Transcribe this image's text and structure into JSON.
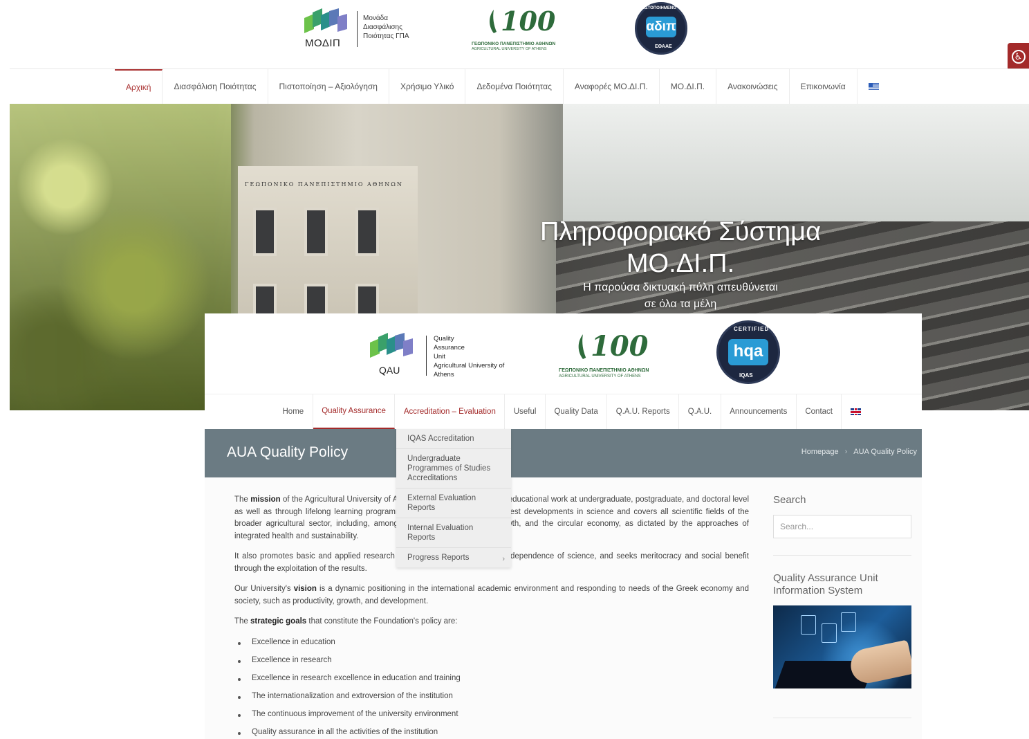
{
  "gr": {
    "logo": {
      "abbr": "ΜΟΔΙΠ",
      "subtitle": "Μονάδα\nΔιασφάλισης\nΠοιότητας ΓΠΑ"
    },
    "centennial": {
      "number": "100",
      "line1": "ΓΕΩΠΟΝΙΚΟ ΠΑΝΕΠΙΣΤΗΜΙΟ ΑΘΗΝΩΝ",
      "line2": "AGRICULTURAL UNIVERSITY OF ATHENS"
    },
    "seal": {
      "mark": "αδιπ",
      "ring": "ΠΙΣΤΟΠΟΙΗΜΕΝΟ",
      "bottom": "ΕΘΑΑΕ"
    },
    "nav": [
      "Αρχική",
      "Διασφάλιση Ποιότητας",
      "Πιστοποίηση – Αξιολόγηση",
      "Χρήσιμο Υλικό",
      "Δεδομένα Ποιότητας",
      "Αναφορές ΜΟ.ΔΙ.Π.",
      "ΜΟ.ΔΙ.Π.",
      "Ανακοινώσεις",
      "Επικοινωνία"
    ],
    "hero": {
      "title": "Πληροφοριακό Σύστημα ΜΟ.ΔΙ.Π.",
      "subtitle": "Η παρούσα δικτυακή πύλη απευθύνεται σε όλα τα μέλη",
      "banner": "ΓΕΩΠΟΝΙΚΟ ΠΑΝΕΠΙΣΤΗΜΙΟ ΑΘΗΝΩΝ"
    }
  },
  "en": {
    "logo": {
      "abbr": "QAU",
      "subtitle": "Quality\nAssurance\nUnit\nAgricultural University of\nAthens"
    },
    "centennial": {
      "number": "100",
      "line1": "ΓΕΩΠΟΝΙΚΟ ΠΑΝΕΠΙΣΤΗΜΙΟ ΑΘΗΝΩΝ",
      "line2": "AGRICULTURAL UNIVERSITY OF ATHENS"
    },
    "seal": {
      "mark": "hqa",
      "ring": "CERTIFIED",
      "bottom": "IQAS"
    },
    "nav": [
      "Home",
      "Quality Assurance",
      "Accreditation – Evaluation",
      "Useful",
      "Quality Data",
      "Q.A.U. Reports",
      "Q.A.U.",
      "Announcements",
      "Contact"
    ],
    "page_title": "AUA Quality Policy",
    "breadcrumb": {
      "home": "Homepage",
      "sep": "›",
      "current": "AUA Quality Policy"
    },
    "dropdown": [
      "IQAS Accreditation",
      "Undergraduate Programmes of Studies Accreditations",
      "External Evaluation Reports",
      "Internal Evaluation Reports",
      "Progress Reports"
    ],
    "dropdown_chevron": "›",
    "content": {
      "p1": {
        "pre": "The ",
        "bold": "mission",
        "post": " of the Agricultural University of Athens is to provide high-quality educational work at undergraduate, postgraduate, and doctoral level as well as through lifelong learning programmes, which incorporates the latest developments in science and covers all scientific fields of the broader agricultural sector, including, among others, biodiversity, blue growth, and the circular economy, as dictated by the approaches of integrated health and sustainability."
      },
      "p2": "It also promotes basic and applied research and innovation, respects the independence of science, and seeks meritocracy and social benefit through the exploitation of the results.",
      "p3": {
        "pre": "Our University's ",
        "bold": "vision",
        "post": " is a dynamic positioning in the international academic environment and responding to needs of the Greek economy and society, such as productivity, growth, and development."
      },
      "p4": {
        "pre": "The ",
        "bold": "strategic goals",
        "post": " that constitute the Foundation's policy are:"
      },
      "goals": [
        "Excellence in education",
        "Excellence in research",
        "Excellence in research excellence in education and training",
        "The internationalization and extroversion of the institution",
        "The continuous improvement of the university environment",
        "Quality assurance in all the activities of the institution"
      ]
    },
    "sidebar": {
      "search_title": "Search",
      "search_placeholder": "Search...",
      "qa_title": "Quality Assurance Unit Information System"
    }
  },
  "colors": {
    "accent": "#a32a2a",
    "pagebar": "#6b7b83",
    "logo_green": "#3e8f4f",
    "logo_blue": "#5d7bb8"
  }
}
